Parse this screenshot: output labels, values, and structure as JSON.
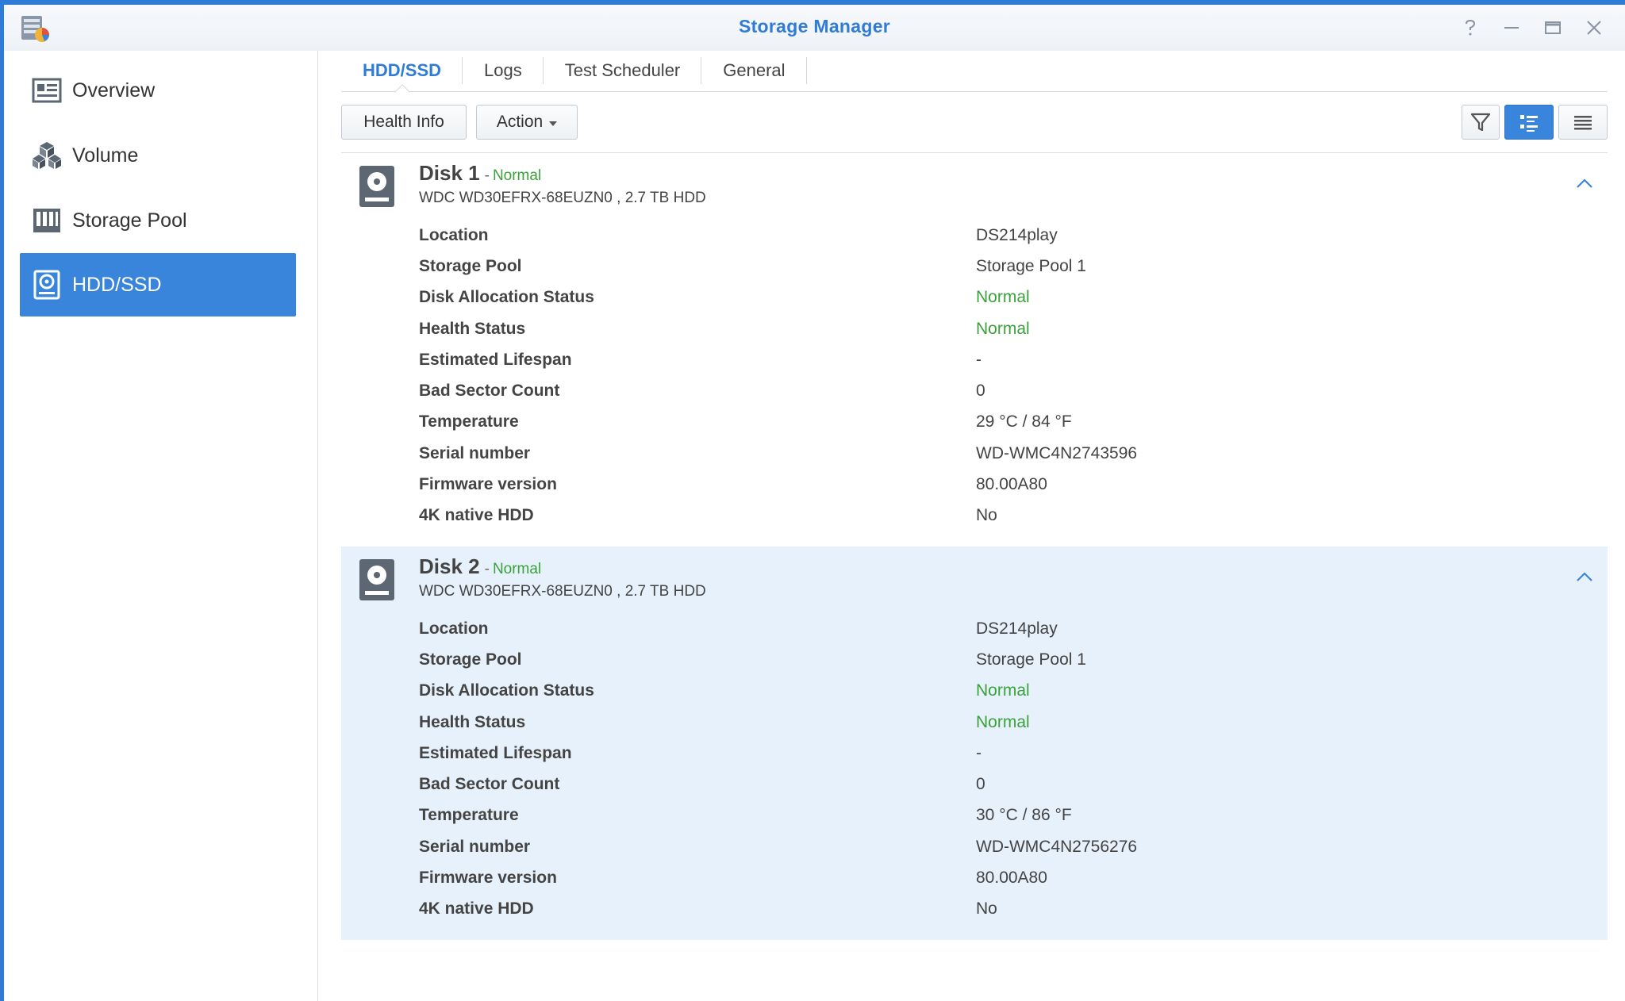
{
  "window": {
    "title": "Storage Manager"
  },
  "sidebar": {
    "items": [
      {
        "label": "Overview"
      },
      {
        "label": "Volume"
      },
      {
        "label": "Storage Pool"
      },
      {
        "label": "HDD/SSD"
      }
    ]
  },
  "tabs": [
    {
      "label": "HDD/SSD"
    },
    {
      "label": "Logs"
    },
    {
      "label": "Test Scheduler"
    },
    {
      "label": "General"
    }
  ],
  "toolbar": {
    "health_info_label": "Health Info",
    "action_label": "Action"
  },
  "disks": [
    {
      "name": "Disk 1",
      "dash": "-",
      "status": "Normal",
      "model": "WDC WD30EFRX-68EUZN0 , 2.7 TB HDD",
      "rows": [
        {
          "key": "Location",
          "value": "DS214play"
        },
        {
          "key": "Storage Pool",
          "value": "Storage Pool 1"
        },
        {
          "key": "Disk Allocation Status",
          "value": "Normal"
        },
        {
          "key": "Health Status",
          "value": "Normal"
        },
        {
          "key": "Estimated Lifespan",
          "value": "-"
        },
        {
          "key": "Bad Sector Count",
          "value": "0"
        },
        {
          "key": "Temperature",
          "value": "29 °C / 84 °F"
        },
        {
          "key": "Serial number",
          "value": "WD-WMC4N2743596"
        },
        {
          "key": "Firmware version",
          "value": "80.00A80"
        },
        {
          "key": "4K native HDD",
          "value": "No"
        }
      ]
    },
    {
      "name": "Disk 2",
      "dash": "-",
      "status": "Normal",
      "model": "WDC WD30EFRX-68EUZN0 , 2.7 TB HDD",
      "rows": [
        {
          "key": "Location",
          "value": "DS214play"
        },
        {
          "key": "Storage Pool",
          "value": "Storage Pool 1"
        },
        {
          "key": "Disk Allocation Status",
          "value": "Normal"
        },
        {
          "key": "Health Status",
          "value": "Normal"
        },
        {
          "key": "Estimated Lifespan",
          "value": "-"
        },
        {
          "key": "Bad Sector Count",
          "value": "0"
        },
        {
          "key": "Temperature",
          "value": "30 °C / 86 °F"
        },
        {
          "key": "Serial number",
          "value": "WD-WMC4N2756276"
        },
        {
          "key": "Firmware version",
          "value": "80.00A80"
        },
        {
          "key": "4K native HDD",
          "value": "No"
        }
      ]
    }
  ],
  "colors": {
    "accent": "#2f7bd8",
    "selected_row": "#e6f1fb",
    "ok_green": "#3aa23a"
  }
}
